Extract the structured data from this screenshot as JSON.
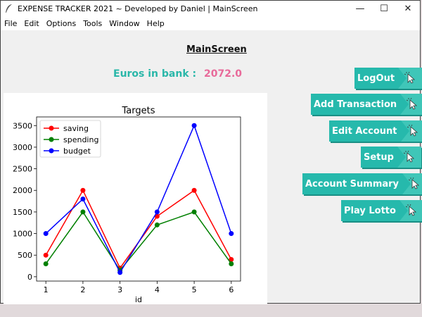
{
  "window": {
    "title": "EXPENSE TRACKER 2021 ~ Developed by Daniel | MainScreen",
    "controls": {
      "minimize": "—",
      "maximize": "☐",
      "close": "✕"
    }
  },
  "menu": [
    "File",
    "Edit",
    "Options",
    "Tools",
    "Window",
    "Help"
  ],
  "main": {
    "title": "MainScreen",
    "bank_label": "Euros in bank :",
    "bank_value": "2072.0"
  },
  "buttons": [
    {
      "label": "LogOut",
      "icon": "cursor-click-icon"
    },
    {
      "label": "Add Transaction",
      "icon": "cursor-click-icon"
    },
    {
      "label": "Edit Account",
      "icon": "cursor-click-icon"
    },
    {
      "label": "Setup",
      "icon": "cursor-click-icon"
    },
    {
      "label": "Account Summary",
      "icon": "cursor-click-icon"
    },
    {
      "label": "Play Lotto",
      "icon": "cursor-click-icon"
    }
  ],
  "colors": {
    "accent": "#26b9ac",
    "bank_value": "#e86a9a",
    "saving": "#ff0000",
    "spending": "#008000",
    "budget": "#0000ff"
  },
  "chart_data": {
    "type": "line",
    "title": "Targets",
    "xlabel": "id",
    "ylabel": "",
    "x": [
      1,
      2,
      3,
      4,
      5,
      6
    ],
    "xlim": [
      0.75,
      6.25
    ],
    "ylim": [
      -100,
      3700
    ],
    "yticks": [
      0,
      500,
      1000,
      1500,
      2000,
      2500,
      3000,
      3500
    ],
    "legend_position": "top-left",
    "grid": false,
    "series": [
      {
        "name": "saving",
        "color": "#ff0000",
        "values": [
          500,
          2000,
          200,
          1400,
          2000,
          400
        ]
      },
      {
        "name": "spending",
        "color": "#008000",
        "values": [
          300,
          1500,
          150,
          1200,
          1500,
          300
        ]
      },
      {
        "name": "budget",
        "color": "#0000ff",
        "values": [
          1000,
          1800,
          100,
          1500,
          3500,
          1000
        ]
      }
    ]
  }
}
